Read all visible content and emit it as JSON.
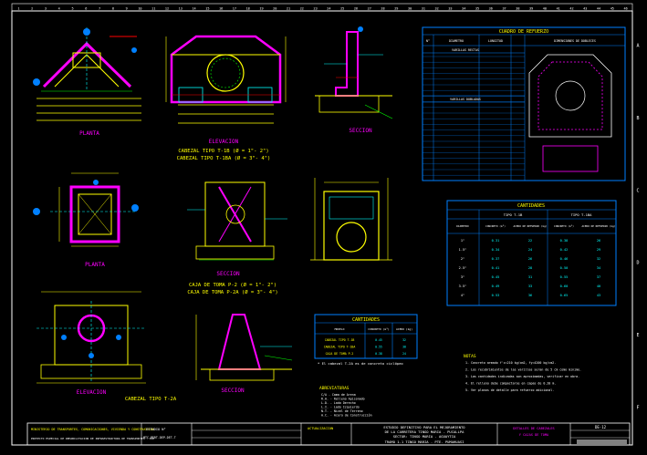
{
  "border": {
    "col_labels": [
      "1",
      "2",
      "3",
      "4",
      "5",
      "6",
      "7",
      "8",
      "9",
      "10",
      "11",
      "12",
      "13",
      "14",
      "15",
      "16",
      "17",
      "18",
      "19",
      "20",
      "21",
      "22",
      "23",
      "24",
      "25",
      "26",
      "27",
      "28",
      "29",
      "30",
      "31",
      "32",
      "33",
      "34",
      "35",
      "36",
      "37",
      "38",
      "39",
      "40",
      "41",
      "42",
      "43",
      "44",
      "45",
      "46"
    ],
    "row_labels": [
      "A",
      "B",
      "C",
      "D",
      "E",
      "F"
    ]
  },
  "views": {
    "planta_top": "PLANTA",
    "elevacion_top": "ELEVACION",
    "seccion_top": "SECCION",
    "cabezal_t1": "CABEZAL TIPO T-1B  (Ø = 1\"- 2\")",
    "cabezal_t2": "CABEZAL TIPO T-1BA (Ø = 3\"- 4\")",
    "planta_mid": "PLANTA",
    "seccion_mid": "SECCION",
    "caja_1": "CAJA DE TOMA P-2  (Ø = 1\"- 2\")",
    "caja_2": "CAJA DE TOMA P-2A (Ø = 3\"- 4\")",
    "elevacion_bot": "ELEVACION",
    "cabezal_bot": "CABEZAL TIPO T-2A"
  },
  "refuerzo": {
    "title": "CUADRO DE REFUERZO",
    "col_headers": [
      "N°",
      "DIAMETRO",
      "LONGITUD",
      "DIMENSIONES DE DOBLECES"
    ],
    "section_1": "VARILLAS RECTAS",
    "section_2": "VARILLAS DOBLADAS"
  },
  "cantidades_right": {
    "title": "CANTIDADES",
    "col_headers": [
      "DIAMETRO",
      "CONCRETO (m³)",
      "ACERO DE REFUERZO (kg)",
      "CONCRETO (m³)",
      "ACERO DE REFUERZO (kg)"
    ],
    "group_headers": [
      "TIPO T-1B",
      "TIPO T-1BA"
    ],
    "rows": [
      [
        "1\"",
        "0.31",
        "22",
        "0.38",
        "26"
      ],
      [
        "1.5\"",
        "0.34",
        "24",
        "0.42",
        "29"
      ],
      [
        "2\"",
        "0.37",
        "26",
        "0.46",
        "32"
      ],
      [
        "2.5\"",
        "0.41",
        "28",
        "0.50",
        "34"
      ],
      [
        "3\"",
        "0.45",
        "31",
        "0.55",
        "37"
      ],
      [
        "3.5\"",
        "0.49",
        "33",
        "0.60",
        "40"
      ],
      [
        "4\"",
        "0.53",
        "36",
        "0.65",
        "43"
      ]
    ]
  },
  "cantidades_mid": {
    "title": "CANTIDADES",
    "col_headers": [
      "MODELO",
      "CONCRETO (m³)",
      "ACERO (kg)"
    ],
    "rows": [
      [
        "CABEZAL TIPO T-1B",
        "0.45",
        "32"
      ],
      [
        "CABEZAL TIPO T-1BA",
        "0.55",
        "38"
      ],
      [
        "CAJA DE TOMA P-2",
        "0.38",
        "24"
      ]
    ],
    "footnote": "* El cabezal T-2A es de concreto ciclópeo"
  },
  "abreviaturas": {
    "title": "ABREVIATURAS",
    "items": [
      "C/A - Cama de Arena",
      "R.A. - Relleno Apisonado",
      "L.D. - Lado Derecho",
      "L.I. - Lado Izquierdo",
      "N.T. - Nivel de Terreno",
      "A.C. - Acero de Construcción"
    ]
  },
  "notas": {
    "title": "NOTAS",
    "items": [
      "1. Concreto armado f'c=210 kg/cm2, fy=4200 kg/cm2.",
      "2. Los recubrimientos de las varillas seran de 5 cm como minimo.",
      "3. Las cantidades indicadas son aproximadas, verificar en obra.",
      "4. El relleno debe compactarse en capas de 0.20 m.",
      "5. Ver planos de detalle para refuerzo adicional."
    ]
  },
  "title_block": {
    "ministry": "MINISTERIO DE TRANSPORTES, COMUNICACIONES, VIVIENDA Y CONSTRUCCION",
    "program": "PROYECTO ESPECIAL DE REHABILITACION DE INFRAESTRUCTURA DE TRANSPORTES - PRT",
    "sheet_label": "ESTUDIO N°",
    "sheet_code": "MTC-PERT-DEP-DET-T",
    "approved": "ACTUALIZACION",
    "project_line1": "ESTUDIO DEFINITIVO PARA EL MEJORAMIENTO",
    "project_line2": "DE LA CARRETERA TINGO MARIA - PUCALLPA",
    "sector": "SECTOR: TINGO MARIA - AGUAYTIA",
    "tramo": "TRAMO 1.1  TINGO MARIA - PTE. PUMAHUASI",
    "drawing_title_1": "DETALLES DE CABEZALES",
    "drawing_title_2": "Y CAJAS DE TOMA",
    "sheet_no": "DE-12"
  }
}
